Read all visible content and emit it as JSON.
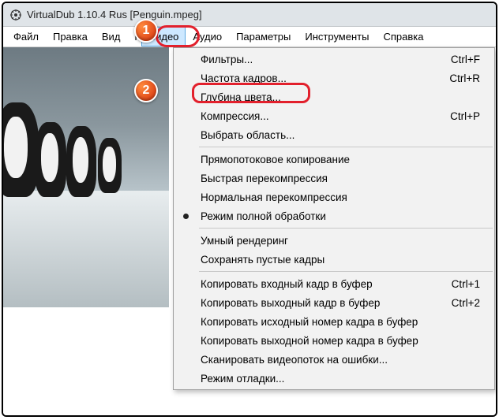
{
  "window": {
    "title": "VirtualDub 1.10.4 Rus [Penguin.mpeg]"
  },
  "menubar": {
    "items": [
      {
        "label": "Файл"
      },
      {
        "label": "Правка"
      },
      {
        "label": "Вид"
      },
      {
        "label": "Переход"
      },
      {
        "label": "Видео"
      },
      {
        "label": "Аудио"
      },
      {
        "label": "Параметры"
      },
      {
        "label": "Инструменты"
      },
      {
        "label": "Справка"
      }
    ]
  },
  "dropdown": {
    "groups": [
      [
        {
          "label": "Фильтры...",
          "shortcut": "Ctrl+F"
        },
        {
          "label": "Частота кадров...",
          "shortcut": "Ctrl+R"
        },
        {
          "label": "Глубина цвета...",
          "shortcut": ""
        },
        {
          "label": "Компрессия...",
          "shortcut": "Ctrl+P"
        },
        {
          "label": "Выбрать область...",
          "shortcut": ""
        }
      ],
      [
        {
          "label": "Прямопотоковое копирование",
          "shortcut": ""
        },
        {
          "label": "Быстрая перекомпрессия",
          "shortcut": ""
        },
        {
          "label": "Нормальная перекомпрессия",
          "shortcut": ""
        },
        {
          "label": "Режим полной обработки",
          "shortcut": "",
          "checked": true
        }
      ],
      [
        {
          "label": "Умный рендеринг",
          "shortcut": ""
        },
        {
          "label": "Сохранять пустые кадры",
          "shortcut": ""
        }
      ],
      [
        {
          "label": "Копировать входный кадр в буфер",
          "shortcut": "Ctrl+1"
        },
        {
          "label": "Копировать выходный кадр в буфер",
          "shortcut": "Ctrl+2"
        },
        {
          "label": "Копировать исходный номер кадра в буфер",
          "shortcut": ""
        },
        {
          "label": "Копировать выходной номер кадра в буфер",
          "shortcut": ""
        },
        {
          "label": "Сканировать видеопоток на ошибки...",
          "shortcut": ""
        },
        {
          "label": "Режим отладки...",
          "shortcut": ""
        }
      ]
    ]
  },
  "annotations": {
    "b1": "1",
    "b2": "2"
  }
}
